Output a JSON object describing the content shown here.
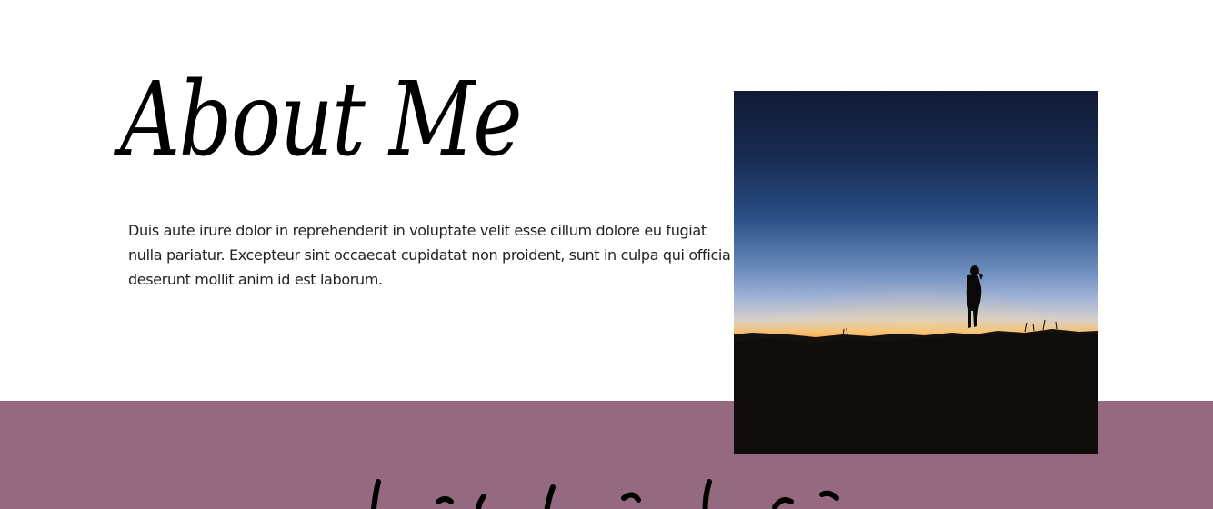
{
  "about": {
    "title": "About Me",
    "body": "Duis aute irure dolor in reprehenderit in voluptate velit esse cillum dolore eu fugiat nulla pariatur. Excepteur sint occaecat cupidatat non proident, sunt in culpa qui officia deserunt mollit anim id est laborum."
  },
  "colors": {
    "section_band": "#95697f",
    "background": "#ffffff",
    "text": "#000000"
  }
}
